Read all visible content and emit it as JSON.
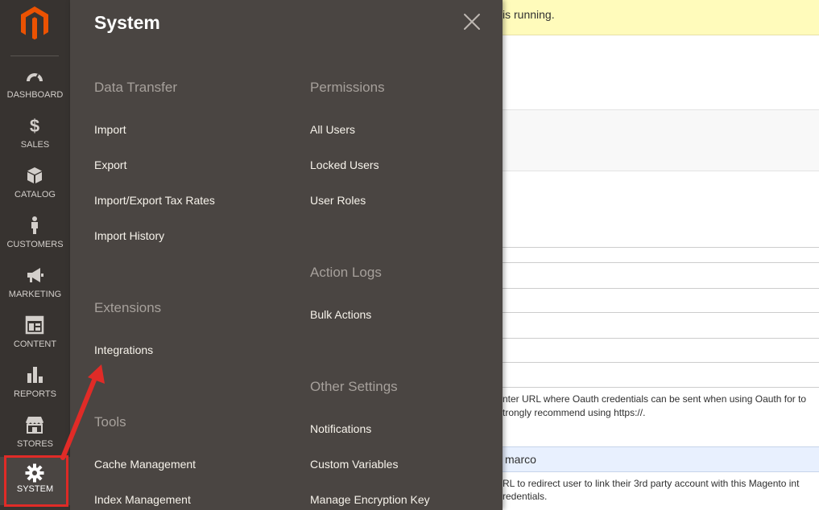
{
  "sidebar": {
    "logo": "magento-logo",
    "items": [
      {
        "label": "DASHBOARD",
        "icon": "dashboard-gauge-icon"
      },
      {
        "label": "SALES",
        "icon": "dollar-icon"
      },
      {
        "label": "CATALOG",
        "icon": "box-icon"
      },
      {
        "label": "CUSTOMERS",
        "icon": "person-icon"
      },
      {
        "label": "MARKETING",
        "icon": "megaphone-icon"
      },
      {
        "label": "CONTENT",
        "icon": "layout-icon"
      },
      {
        "label": "REPORTS",
        "icon": "bar-chart-icon"
      },
      {
        "label": "STORES",
        "icon": "storefront-icon"
      },
      {
        "label": "SYSTEM",
        "icon": "gear-icon"
      }
    ]
  },
  "flyout": {
    "title": "System",
    "close_icon": "close-icon",
    "sections": {
      "data_transfer": {
        "title": "Data Transfer",
        "links": [
          "Import",
          "Export",
          "Import/Export Tax Rates",
          "Import History"
        ]
      },
      "extensions": {
        "title": "Extensions",
        "links": [
          "Integrations"
        ]
      },
      "tools": {
        "title": "Tools",
        "links": [
          "Cache Management",
          "Index Management"
        ]
      },
      "permissions": {
        "title": "Permissions",
        "links": [
          "All Users",
          "Locked Users",
          "User Roles"
        ]
      },
      "action_logs": {
        "title": "Action Logs",
        "links": [
          "Bulk Actions"
        ]
      },
      "other_settings": {
        "title": "Other Settings",
        "links": [
          "Notifications",
          "Custom Variables",
          "Manage Encryption Key"
        ]
      }
    }
  },
  "background": {
    "notice_text": "is running.",
    "note1_line1": "nter URL where Oauth credentials can be sent when using Oauth for to",
    "note1_line2": "trongly recommend using https://.",
    "input_value": "marco",
    "note2_line1": "RL to redirect user to link their 3rd party account with this Magento int",
    "note2_line2": "redentials."
  },
  "colors": {
    "sidebar_bg": "#373330",
    "flyout_bg": "#4a4542",
    "logo_orange": "#eb5202",
    "annotation_red": "#e02b27",
    "notice_bg": "#fffbbb"
  }
}
